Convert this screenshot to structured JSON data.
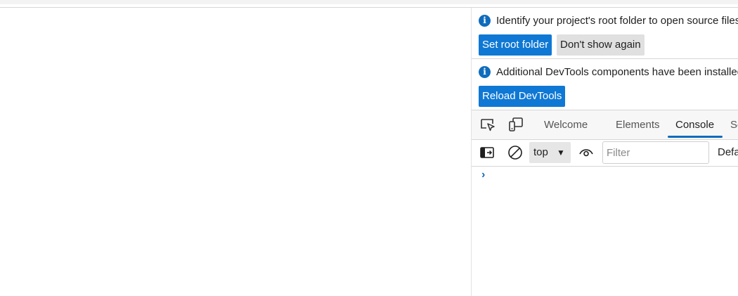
{
  "infobars": [
    {
      "message": "Identify your project's root folder to open source files",
      "buttons": [
        {
          "label": "Set root folder"
        },
        {
          "label": "Don't show again"
        }
      ]
    },
    {
      "message": "Additional DevTools components have been installed",
      "buttons": [
        {
          "label": "Reload DevTools"
        }
      ]
    }
  ],
  "tabbar": {
    "icons": [
      "inspect-element-icon",
      "device-emulation-icon"
    ],
    "tabs": [
      {
        "label": "Welcome"
      },
      {
        "label": "Elements"
      },
      {
        "label": "Console",
        "active": true
      },
      {
        "label": "Sources"
      }
    ]
  },
  "console_toolbar": {
    "icons": [
      "sidebar-toggle-icon",
      "clear-console-icon",
      "live-expression-eye-icon"
    ],
    "context": "top",
    "filter_placeholder": "Filter",
    "levels": "Default levels"
  },
  "prompt_glyph": "›",
  "colors": {
    "accent": "#0f6cbd",
    "primary_button": "#0f78d4"
  }
}
